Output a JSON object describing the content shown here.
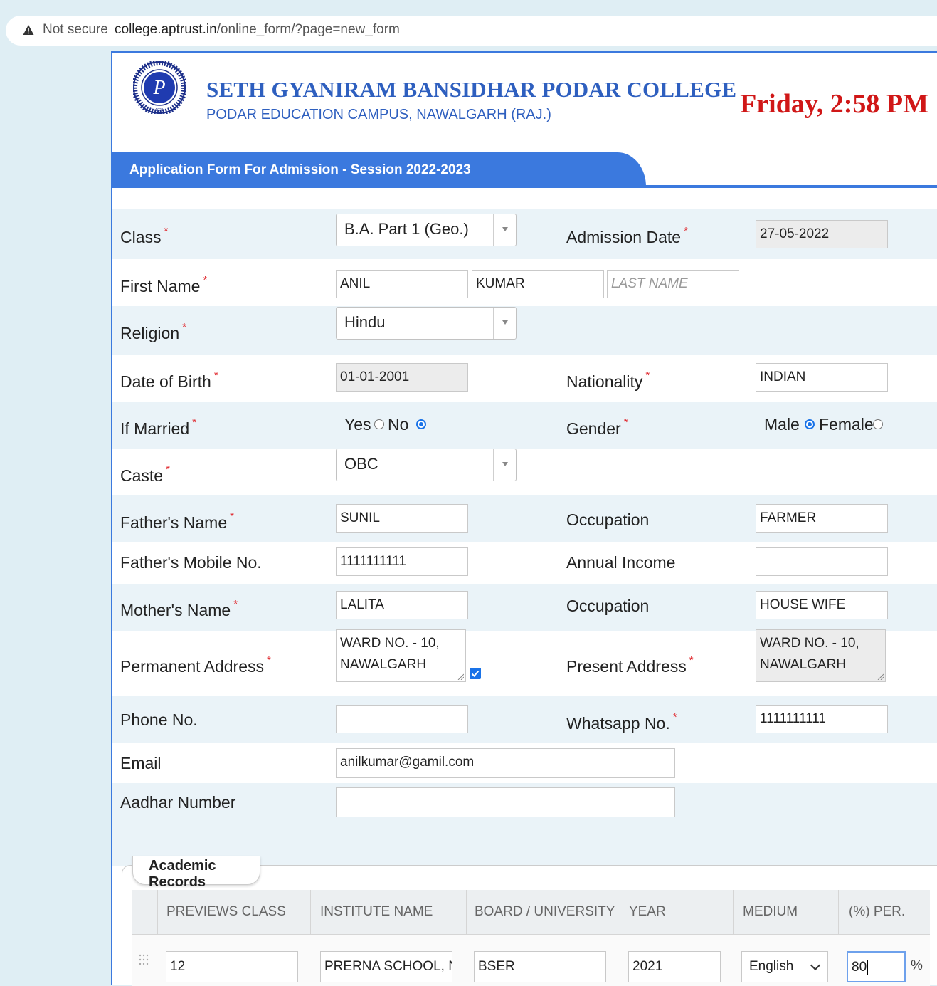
{
  "browser": {
    "security_label": "Not secure",
    "url_host": "college.aptrust.in",
    "url_path": "/online_form/?page=new_form"
  },
  "header": {
    "college_name": "SETH GYANIRAM BANSIDHAR PODAR COLLEGE",
    "campus": "PODAR EDUCATION CAMPUS, NAWALGARH (RAJ.)",
    "clock": "Friday, 2:58 PM",
    "logo_letter": "P",
    "logo_ring_top": "EDUCATIONAL INSTITUTIONS",
    "logo_ring_bottom": "PODAR",
    "logo_year": "1921"
  },
  "form": {
    "title": "Application Form For Admission - Session 2022-2023",
    "required_mark": "*",
    "class_label": "Class",
    "class_value": "B.A. Part 1 (Geo.)",
    "admission_date_label": "Admission Date",
    "admission_date_value": "27-05-2022",
    "first_name_label": "First Name",
    "first_name_value": "ANIL",
    "middle_name_value": "KUMAR",
    "last_name_placeholder": "LAST NAME",
    "religion_label": "Religion",
    "religion_value": "Hindu",
    "dob_label": "Date of Birth",
    "dob_value": "01-01-2001",
    "nationality_label": "Nationality",
    "nationality_value": "INDIAN",
    "married_label": "If Married",
    "married_yes": "Yes",
    "married_no": "No",
    "married_selected": "No",
    "gender_label": "Gender",
    "gender_male": "Male",
    "gender_female": "Female",
    "gender_selected": "Male",
    "caste_label": "Caste",
    "caste_value": "OBC",
    "father_name_label": "Father's Name",
    "father_name_value": "SUNIL",
    "father_occupation_label": "Occupation",
    "father_occupation_value": "FARMER",
    "father_mobile_label": "Father's Mobile No.",
    "father_mobile_value": "1111111111",
    "annual_income_label": "Annual Income",
    "annual_income_value": "",
    "mother_name_label": "Mother's Name",
    "mother_name_value": "LALITA",
    "mother_occupation_label": "Occupation",
    "mother_occupation_value": "HOUSE WIFE",
    "permanent_address_label": "Permanent Address",
    "permanent_address_line1": "WARD NO. - 10,",
    "permanent_address_line2": "NAWALGARH",
    "same_address_checked": true,
    "present_address_label": "Present Address",
    "present_address_line1": "WARD NO. - 10,",
    "present_address_line2": "NAWALGARH",
    "phone_label": "Phone No.",
    "phone_value": "",
    "whatsapp_label": "Whatsapp No.",
    "whatsapp_value": "1111111111",
    "email_label": "Email",
    "email_value": "anilkumar@gamil.com",
    "aadhar_label": "Aadhar Number",
    "aadhar_value": ""
  },
  "academic": {
    "legend": "Academic Records",
    "columns": [
      "PREVIEWS CLASS",
      "INSTITUTE NAME",
      "BOARD / UNIVERSITY",
      "YEAR",
      "MEDIUM",
      "(%) PER."
    ],
    "row": {
      "class": "12",
      "institute": "PRERNA SCHOOL, NAWA",
      "board": "BSER",
      "year": "2021",
      "medium": "English",
      "percent": "80",
      "percent_suffix": "%"
    }
  },
  "colors": {
    "accent": "#3b79de",
    "title_blue": "#2e5fbf",
    "clock_red": "#d01717",
    "required_red": "#e0262c",
    "alt_row": "#eaf3f8"
  },
  "icons": [
    "warning-triangle-icon",
    "checkbox-checked-icon",
    "drag-handle-icon",
    "chevron-down-icon",
    "college-logo"
  ]
}
